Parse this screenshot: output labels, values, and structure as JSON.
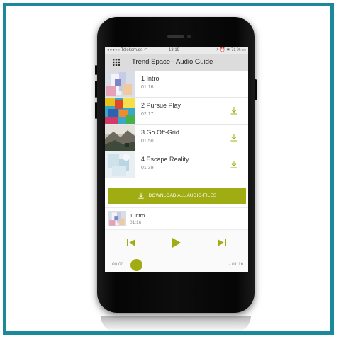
{
  "statusbar": {
    "carrier": "Telekom.de",
    "time": "13:19",
    "battery": "71 %"
  },
  "appbar": {
    "title": "Trend Space - Audio Guide",
    "menu_icon": "grid-icon"
  },
  "tracks": [
    {
      "title": "1 Intro",
      "duration": "01:16",
      "downloadable": false
    },
    {
      "title": "2 Pursue Play",
      "duration": "02:17",
      "downloadable": true
    },
    {
      "title": "3 Go Off-Grid",
      "duration": "01:50",
      "downloadable": true
    },
    {
      "title": "4 Escape Reality",
      "duration": "01:39",
      "downloadable": true
    }
  ],
  "download_all": {
    "label": "DOWNLOAD ALL AUDIO-FILES",
    "icon": "download-icon"
  },
  "now_playing": {
    "title": "1 Intro",
    "time": "01:16"
  },
  "player": {
    "elapsed": "00:00",
    "remaining": "- 01:16",
    "progress": 0,
    "icons": [
      "skip-previous-icon",
      "play-icon",
      "skip-next-icon"
    ]
  },
  "colors": {
    "accent": "#9fac12",
    "frame": "#1a8a9a",
    "appbar": "#dcdcdc"
  }
}
